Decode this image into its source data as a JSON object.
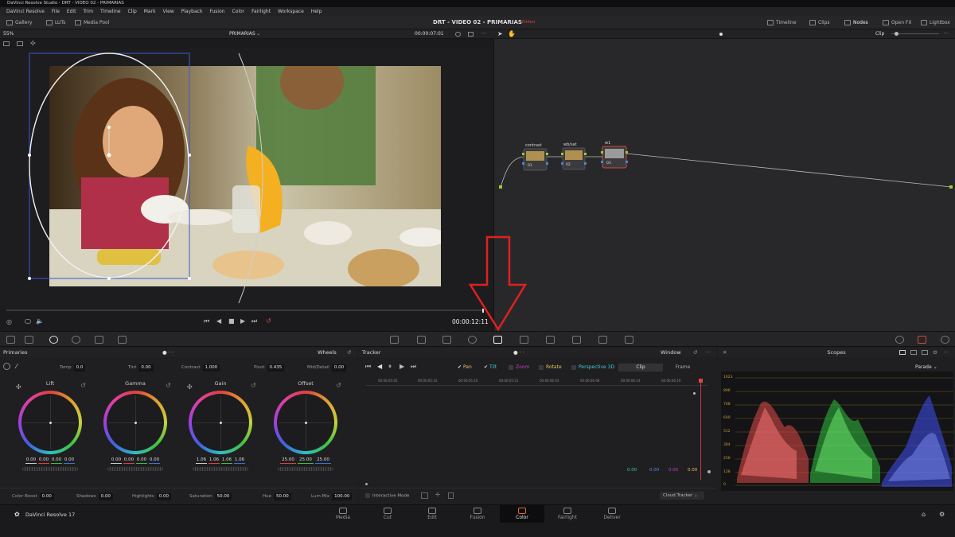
{
  "app": {
    "window_title": "DaVinci Resolve Studio - DRT - VIDEO 02 - PRIMARIAS",
    "menu": [
      "DaVinci Resolve",
      "File",
      "Edit",
      "Trim",
      "Timeline",
      "Clip",
      "Mark",
      "View",
      "Playback",
      "Fusion",
      "Color",
      "Fairlight",
      "Workspace",
      "Help"
    ],
    "project_title": "DRT - VIDEO 02 - PRIMARIAS",
    "edited_badge": "Edited"
  },
  "toolbar": {
    "gallery": "Gallery",
    "luts": "LUTs",
    "media_pool": "Media Pool",
    "timeline": "Timeline",
    "clips": "Clips",
    "nodes": "Nodes",
    "openfx": "Open FX",
    "lightbox": "Lightbox"
  },
  "viewer": {
    "zoom": "55%",
    "clip_name": "PRIMARIAS",
    "source_tc": "00:00:07:01",
    "timecode": "00:00:12:11"
  },
  "node_editor": {
    "mode": "Clip",
    "nodes": [
      {
        "label": "contrast",
        "number": "01"
      },
      {
        "label": "wb/sat",
        "number": "02"
      },
      {
        "label": "w1",
        "number": "03"
      }
    ]
  },
  "primaries": {
    "title": "Primaries",
    "mode": "Wheels",
    "temp_label": "Temp",
    "temp": "0.0",
    "tint_label": "Tint",
    "tint": "0.00",
    "contrast_label": "Contrast",
    "contrast": "1.000",
    "pivot_label": "Pivot",
    "pivot": "0.435",
    "middetail_label": "Mid/Detail",
    "middetail": "0.00",
    "wheels": [
      {
        "name": "Lift",
        "values": [
          "0.00",
          "0.00",
          "0.00",
          "0.00"
        ]
      },
      {
        "name": "Gamma",
        "values": [
          "0.00",
          "0.00",
          "0.00",
          "0.00"
        ]
      },
      {
        "name": "Gain",
        "values": [
          "1.06",
          "1.06",
          "1.06",
          "1.06"
        ]
      },
      {
        "name": "Offset",
        "values": [
          "25.00",
          "25.00",
          "25.00"
        ]
      }
    ],
    "color_boost_label": "Color Boost",
    "color_boost": "0.00",
    "shadows_label": "Shadows",
    "shadows": "0.00",
    "highlights_label": "Highlights",
    "highlights": "0.00",
    "saturation_label": "Saturation",
    "saturation": "50.00",
    "hue_label": "Hue",
    "hue": "50.00",
    "lum_mix_label": "Lum Mix",
    "lum_mix": "100.00"
  },
  "tracker": {
    "title": "Tracker",
    "mode": "Window",
    "options": [
      "Pan",
      "Tilt",
      "Zoom",
      "Rotate",
      "Perspective 3D"
    ],
    "seg_clip": "Clip",
    "seg_frame": "Frame",
    "ruler": [
      "00:00:05:05",
      "00:00:05:10",
      "00:00:05:16",
      "00:00:05:21",
      "00:00:06:03",
      "00:00:06:08",
      "00:00:06:14",
      "00:00:06:19"
    ],
    "graph_values": [
      "0.00",
      "0.00",
      "0.00",
      "0.00"
    ],
    "interactive_mode": "Interactive Mode",
    "cloud_tracker": "Cloud Tracker"
  },
  "scopes": {
    "title": "Scopes",
    "mode": "Parade",
    "scale": [
      "1023",
      "896",
      "768",
      "640",
      "512",
      "384",
      "256",
      "128",
      "0"
    ]
  },
  "bottom": {
    "brand": "DaVinci Resolve 17",
    "pages": [
      "Media",
      "Cut",
      "Edit",
      "Fusion",
      "Color",
      "Fairlight",
      "Deliver"
    ],
    "active_page": "Color"
  }
}
